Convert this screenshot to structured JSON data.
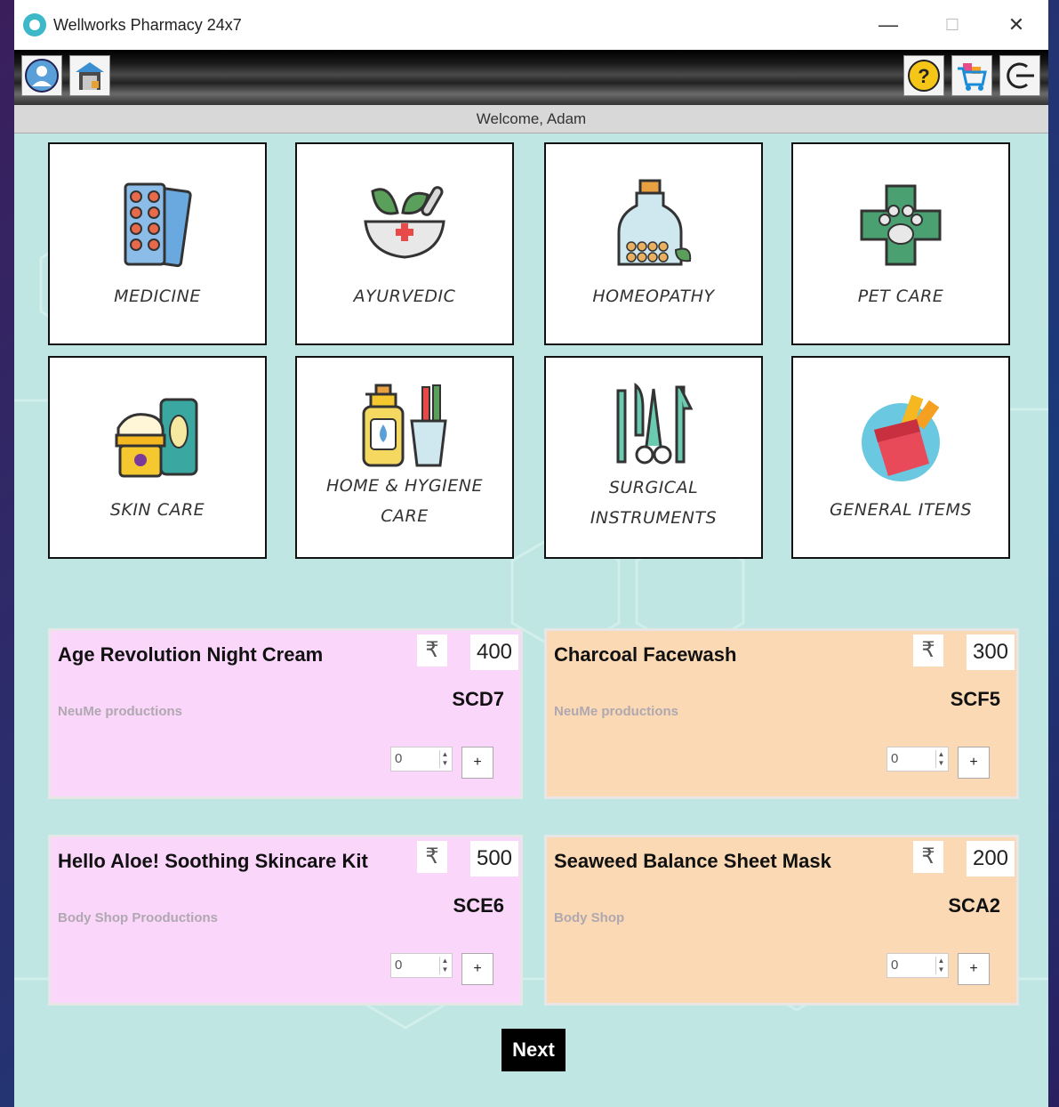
{
  "window": {
    "title": "Wellworks Pharmacy 24x7",
    "controls": {
      "minimize": "—",
      "maximize": "☐",
      "close": "✕"
    }
  },
  "toolbar": {
    "left_icons": [
      "user-profile-icon",
      "home-store-icon"
    ],
    "right_icons": [
      "help-icon",
      "cart-icon",
      "logout-icon"
    ]
  },
  "welcome_text": "Welcome, Adam",
  "categories": [
    {
      "label": "MEDICINE",
      "icon": "pill-blister-icon"
    },
    {
      "label": "AYURVEDIC",
      "icon": "mortar-pestle-icon"
    },
    {
      "label": "HOMEOPATHY",
      "icon": "homeopathy-bottle-icon"
    },
    {
      "label": "PET CARE",
      "icon": "pet-paw-cross-icon"
    },
    {
      "label": "SKIN CARE",
      "icon": "skincare-cream-icon"
    },
    {
      "label": "HOME & HYGIENE CARE",
      "icon": "soap-toothbrush-icon"
    },
    {
      "label": "SURGICAL INSTRUMENTS",
      "icon": "surgical-tools-icon"
    },
    {
      "label": "GENERAL ITEMS",
      "icon": "general-items-icon"
    }
  ],
  "currency_symbol": "₹",
  "products": [
    {
      "name": "Age Revolution Night Cream",
      "price": "400",
      "code": "SCD7",
      "maker": "NeuMe productions",
      "qty": "0",
      "add": "+",
      "theme": "pink"
    },
    {
      "name": "Charcoal Facewash",
      "price": "300",
      "code": "SCF5",
      "maker": "NeuMe productions",
      "qty": "0",
      "add": "+",
      "theme": "peach"
    },
    {
      "name": "Hello Aloe! Soothing Skincare Kit",
      "price": "500",
      "code": "SCE6",
      "maker": "Body Shop Prooductions",
      "qty": "0",
      "add": "+",
      "theme": "pink"
    },
    {
      "name": "Seaweed Balance Sheet Mask",
      "price": "200",
      "code": "SCA2",
      "maker": "Body Shop",
      "qty": "0",
      "add": "+",
      "theme": "peach"
    }
  ],
  "next_label": "Next",
  "colors": {
    "window_bg": "#bfe6e2",
    "pink_card": "#fbd6fb",
    "peach_card": "#fad9b4",
    "next_bg": "#000000"
  }
}
